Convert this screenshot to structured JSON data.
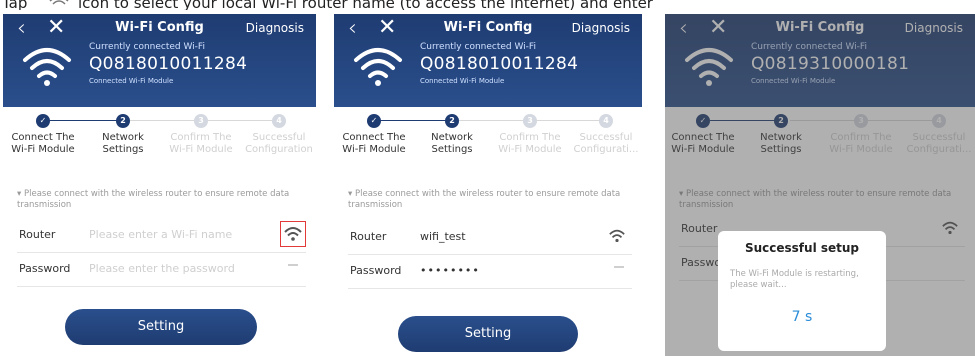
{
  "caption": {
    "tap": "Tap",
    "rest": "icon to select your local Wi-Fi router name (to access the internet) and enter"
  },
  "screens": [
    {
      "header": {
        "title": "Wi-Fi Config",
        "diagnosis": "Diagnosis",
        "connected_label": "Currently connected Wi-Fi",
        "connected_id": "Q0818010011284",
        "connected_sub": "Connected Wi-Fi Module"
      },
      "steps": [
        "Connect The Wi-Fi Module",
        "Network Settings",
        "Confirm The Wi-Fi Module",
        "Successful Configuration"
      ],
      "notice": "Please connect with the wireless router to ensure remote data transmission",
      "router": {
        "label": "Router",
        "placeholder": "Please enter a Wi-Fi name"
      },
      "password": {
        "label": "Password",
        "placeholder": "Please enter the password"
      },
      "button": "Setting"
    },
    {
      "header": {
        "title": "Wi-Fi Config",
        "diagnosis": "Diagnosis",
        "connected_label": "Currently connected Wi-Fi",
        "connected_id": "Q0818010011284",
        "connected_sub": "Connected Wi-Fi Module"
      },
      "steps": [
        "Connect The Wi-Fi Module",
        "Network Settings",
        "Confirm The Wi-Fi Module",
        "Successful Configurati..."
      ],
      "notice": "Please connect with the wireless router to ensure remote data transmission",
      "router": {
        "label": "Router",
        "value": "wifi_test"
      },
      "password": {
        "label": "Password",
        "value": "••••••••"
      },
      "button": "Setting"
    },
    {
      "header": {
        "title": "Wi-Fi Config",
        "diagnosis": "Diagnosis",
        "connected_label": "Currently connected Wi-Fi",
        "connected_id": "Q0819310000181",
        "connected_sub": "Connected Wi-Fi Module"
      },
      "steps": [
        "Connect The Wi-Fi Module",
        "Network Settings",
        "Confirm The Wi-Fi Module",
        "Successful Configurati..."
      ],
      "notice": "Please connect with the wireless router to ensure remote data transmission",
      "router": {
        "label": "Router"
      },
      "password": {
        "label": "Password"
      },
      "modal": {
        "title": "Successful setup",
        "message": "The Wi-Fi Module is restarting, please wait...",
        "countdown": "7 s"
      }
    }
  ],
  "colors": {
    "header": "#1f3c72",
    "accent": "#2a4f8c",
    "highlight": "#e23a3a",
    "countdown": "#2a8cd8"
  }
}
